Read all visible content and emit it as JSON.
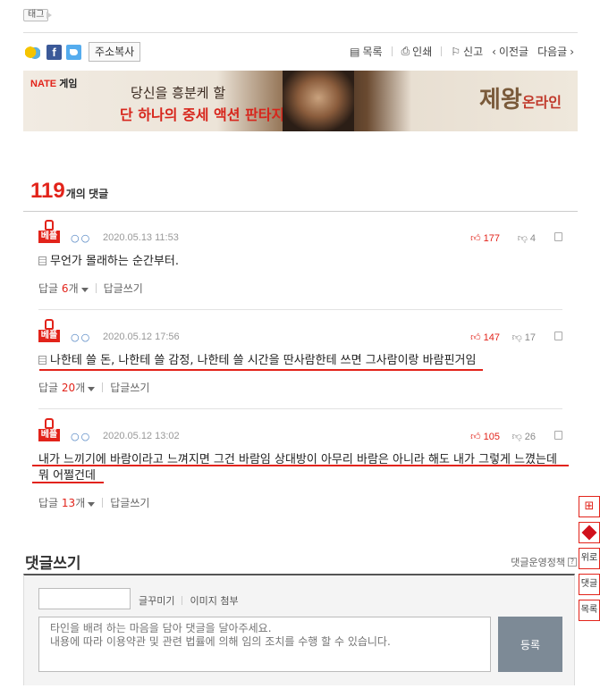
{
  "tag_label": "태그",
  "toolbar": {
    "copy_label": "주소복사",
    "fb_glyph": "f",
    "list": "목록",
    "print": "인쇄",
    "report": "신고",
    "prev": "이전글",
    "next": "다음글"
  },
  "banner": {
    "brand": "NATE",
    "brand_suffix": "게임",
    "line1": "당신을 흥분케 할",
    "line2": "단 하나의 중세 액션 판타지!",
    "game": "제왕",
    "game_suffix": "온라인"
  },
  "comments_header": {
    "count": "119",
    "label": "개의 댓글"
  },
  "comments": [
    {
      "badge": "베플",
      "author": "○○",
      "date": "2020.05.13 11:53",
      "likes": "177",
      "dislikes": "4",
      "text": "무언가 몰래하는 순간부터.",
      "reply_prefix": "답글",
      "reply_count": "6",
      "reply_suffix": "개",
      "write_reply": "답글쓰기"
    },
    {
      "badge": "베플",
      "author": "○○",
      "date": "2020.05.12 17:56",
      "likes": "147",
      "dislikes": "17",
      "text": "나한테 쓸 돈, 나한테 쓸 감정, 나한테 쓸 시간을 딴사람한테 쓰면 그사람이랑 바람핀거임",
      "reply_prefix": "답글",
      "reply_count": "20",
      "reply_suffix": "개",
      "write_reply": "답글쓰기"
    },
    {
      "badge": "베플",
      "author": "○○",
      "date": "2020.05.12 13:02",
      "likes": "105",
      "dislikes": "26",
      "text": "내가 느끼기에 바람이라고 느껴지면 그건 바람임 상대방이 아무리 바람은 아니라 해도 내가 그렇게 느꼈는데 뭐 어쩔건데",
      "reply_prefix": "답글",
      "reply_count": "13",
      "reply_suffix": "개",
      "write_reply": "답글쓰기"
    }
  ],
  "write": {
    "title": "댓글쓰기",
    "policy": "댓글운영정책",
    "policy_icon": "?",
    "decorate": "글꾸미기",
    "attach_image": "이미지 첨부",
    "placeholder": "타인을 배려 하는 마음을 담아 댓글을 달아주세요.\n내용에 따라 이용약관 및 관련 법률에 의해 임의 조치를 수행 할 수 있습니다.",
    "submit": "등록"
  },
  "side_tools": {
    "up": "위로",
    "comment": "댓글",
    "list": "목록"
  },
  "colors": {
    "accent": "#e2231a",
    "submit_bg": "#7d8a96"
  }
}
